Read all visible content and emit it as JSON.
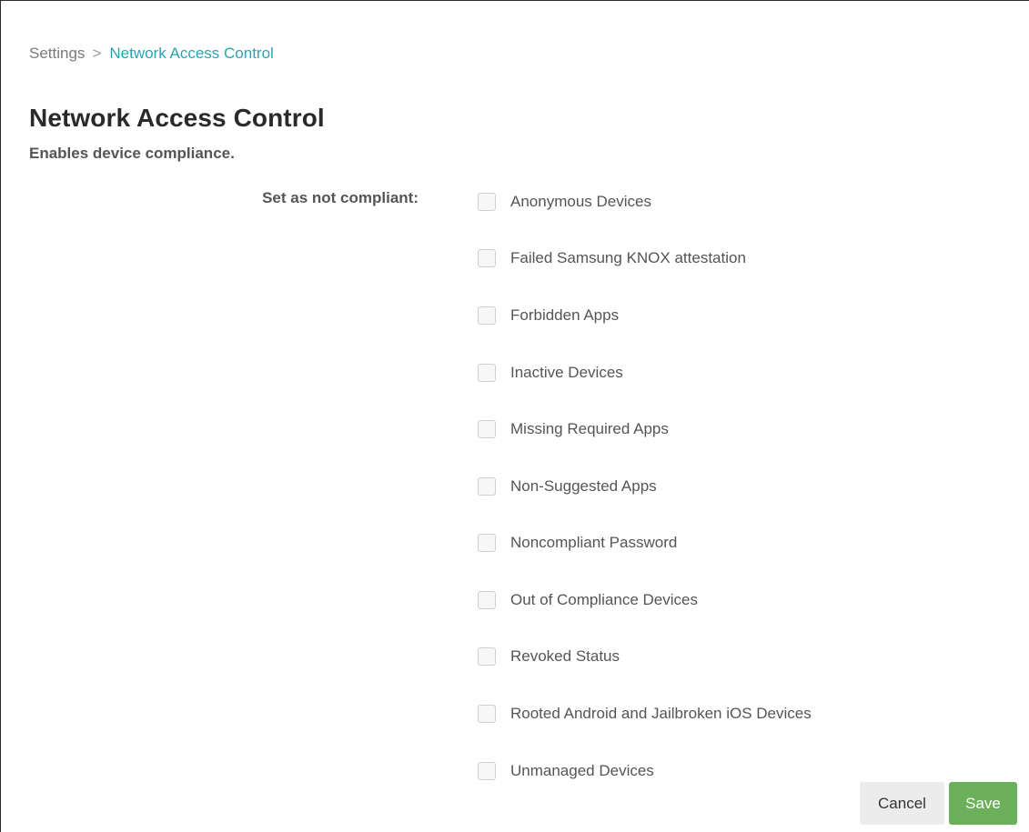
{
  "breadcrumb": {
    "root": "Settings",
    "separator": ">",
    "current": "Network Access Control"
  },
  "page": {
    "title": "Network Access Control",
    "subtitle": "Enables device compliance."
  },
  "form": {
    "label": "Set as not compliant:",
    "options": [
      {
        "label": "Anonymous Devices",
        "checked": false
      },
      {
        "label": "Failed Samsung KNOX attestation",
        "checked": false
      },
      {
        "label": "Forbidden Apps",
        "checked": false
      },
      {
        "label": "Inactive Devices",
        "checked": false
      },
      {
        "label": "Missing Required Apps",
        "checked": false
      },
      {
        "label": "Non-Suggested Apps",
        "checked": false
      },
      {
        "label": "Noncompliant Password",
        "checked": false
      },
      {
        "label": "Out of Compliance Devices",
        "checked": false
      },
      {
        "label": "Revoked Status",
        "checked": false
      },
      {
        "label": "Rooted Android and Jailbroken iOS Devices",
        "checked": false
      },
      {
        "label": "Unmanaged Devices",
        "checked": false
      }
    ]
  },
  "actions": {
    "cancel_label": "Cancel",
    "save_label": "Save"
  },
  "colors": {
    "accent_link": "#2aa3b3",
    "save_button": "#6db05b",
    "cancel_button": "#ececec"
  }
}
